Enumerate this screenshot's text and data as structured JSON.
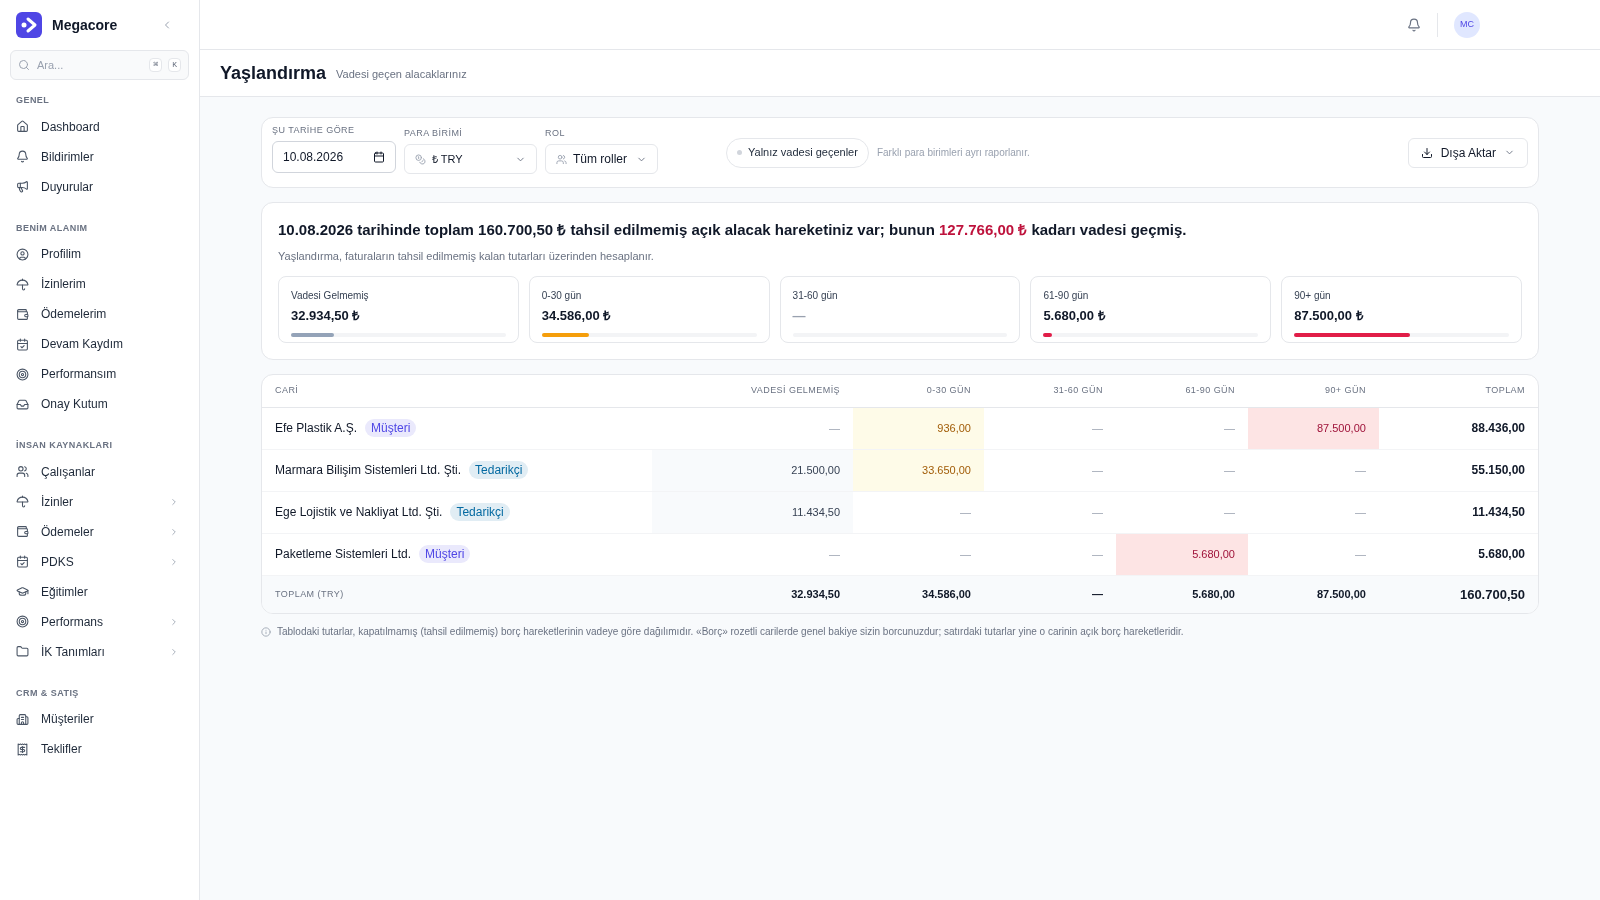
{
  "brand": {
    "name": "Megacore"
  },
  "search": {
    "placeholder": "Ara...",
    "keys": [
      "⌘",
      "K"
    ]
  },
  "sidebar": {
    "sections": [
      {
        "title": "GENEL",
        "items": [
          {
            "label": "Dashboard",
            "has_children": false
          },
          {
            "label": "Bildirimler",
            "has_children": false
          },
          {
            "label": "Duyurular",
            "has_children": false
          }
        ]
      },
      {
        "title": "BENİM ALANIM",
        "items": [
          {
            "label": "Profilim",
            "has_children": false
          },
          {
            "label": "İzinlerim",
            "has_children": false
          },
          {
            "label": "Ödemelerim",
            "has_children": false
          },
          {
            "label": "Devam Kaydım",
            "has_children": false
          },
          {
            "label": "Performansım",
            "has_children": false
          },
          {
            "label": "Onay Kutum",
            "has_children": false
          }
        ]
      },
      {
        "title": "İNSAN KAYNAKLARI",
        "items": [
          {
            "label": "Çalışanlar",
            "has_children": false
          },
          {
            "label": "İzinler",
            "has_children": true
          },
          {
            "label": "Ödemeler",
            "has_children": true
          },
          {
            "label": "PDKS",
            "has_children": true
          },
          {
            "label": "Eğitimler",
            "has_children": false
          },
          {
            "label": "Performans",
            "has_children": true
          },
          {
            "label": "İK Tanımları",
            "has_children": true
          }
        ]
      },
      {
        "title": "CRM & SATIŞ",
        "items": [
          {
            "label": "Müşteriler",
            "has_children": false
          },
          {
            "label": "Teklifler",
            "has_children": false
          }
        ]
      }
    ]
  },
  "topbar": {
    "avatar": "MC"
  },
  "page": {
    "title": "Yaşlandırma",
    "subtitle": "Vadesi geçen alacaklarınız"
  },
  "filters": {
    "date": {
      "label": "ŞU TARİHE GÖRE",
      "value": "10.08.2026"
    },
    "currency": {
      "label": "PARA BİRİMİ",
      "value": "₺ TRY"
    },
    "role": {
      "label": "ROL",
      "value": "Tüm roller"
    },
    "overdue_only": {
      "label": "Yalnız vadesi geçenler",
      "on": false
    },
    "note": "Farklı para birimleri ayrı raporlanır.",
    "export": "Dışa Aktar"
  },
  "summary": {
    "headline": "10.08.2026 tarihinde toplam **160.700,50 ₺** tahsil edilmemiş açık alacak hareketiniz var; bunun",
    "overdue": "127.766,00 ₺",
    "headline_end": "kadarı vadesi geçmiş.",
    "description": "Yaşlandırma, faturaların tahsil edilmemiş kalan tutarları üzerinden hesaplanır.",
    "buckets": [
      {
        "label": "Vadesi Gelmemiş",
        "value": "32.934,50 ₺",
        "level": 0.2,
        "color": "#94a3b8"
      },
      {
        "label": "0-30 gün",
        "value": "34.586,00 ₺",
        "level": 0.22,
        "color": "#f59e0b"
      },
      {
        "label": "31-60 gün",
        "value": "—",
        "level": 0
      },
      {
        "label": "61-90 gün",
        "value": "5.680,00 ₺",
        "level": 0.04,
        "color": "#e11d48"
      },
      {
        "label": "90+ gün",
        "value": "87.500,00 ₺",
        "level": 0.54,
        "color": "#e11d48"
      }
    ]
  },
  "table": {
    "columns": [
      "CARİ",
      "VADESİ GELMEMİŞ",
      "0-30 GÜN",
      "31-60 GÜN",
      "61-90 GÜN",
      "90+ GÜN",
      "TOPLAM"
    ],
    "rows": [
      {
        "cells": [
          {
            "kind": "account",
            "text": "Efe Plastik A.Ş.",
            "tag": {
              "label": "Müşteri",
              "color": "#4f46e5"
            }
          },
          {
            "kind": "empty",
            "text": "—"
          },
          {
            "kind": "warn",
            "text": "936,00"
          },
          {
            "kind": "empty",
            "text": "—"
          },
          {
            "kind": "empty",
            "text": "—"
          },
          {
            "kind": "danger",
            "text": "87.500,00"
          },
          {
            "kind": "total",
            "text": "88.436,00"
          }
        ]
      },
      {
        "cells": [
          {
            "kind": "account",
            "text": "Marmara Bilişim Sistemleri Ltd. Şti.",
            "tag": {
              "label": "Tedarikçi",
              "color": "#0369a1"
            }
          },
          {
            "kind": "muted",
            "text": "21.500,00"
          },
          {
            "kind": "warn",
            "text": "33.650,00"
          },
          {
            "kind": "empty",
            "text": "—"
          },
          {
            "kind": "empty",
            "text": "—"
          },
          {
            "kind": "empty",
            "text": "—"
          },
          {
            "kind": "total",
            "text": "55.150,00"
          }
        ]
      },
      {
        "cells": [
          {
            "kind": "account",
            "text": "Ege Lojistik ve Nakliyat Ltd. Şti.",
            "tag": {
              "label": "Tedarikçi",
              "color": "#0369a1"
            }
          },
          {
            "kind": "muted",
            "text": "11.434,50"
          },
          {
            "kind": "empty",
            "text": "—"
          },
          {
            "kind": "empty",
            "text": "—"
          },
          {
            "kind": "empty",
            "text": "—"
          },
          {
            "kind": "empty",
            "text": "—"
          },
          {
            "kind": "total",
            "text": "11.434,50"
          }
        ]
      },
      {
        "cells": [
          {
            "kind": "account",
            "text": "Paketleme Sistemleri Ltd.",
            "tag": {
              "label": "Müşteri",
              "color": "#4f46e5"
            }
          },
          {
            "kind": "empty",
            "text": "—"
          },
          {
            "kind": "empty",
            "text": "—"
          },
          {
            "kind": "empty",
            "text": "—"
          },
          {
            "kind": "danger",
            "text": "5.680,00"
          },
          {
            "kind": "empty",
            "text": "—"
          },
          {
            "kind": "total",
            "text": "5.680,00"
          }
        ]
      }
    ],
    "footer": [
      "TOPLAM (TRY)",
      "32.934,50",
      "34.586,00",
      "—",
      "5.680,00",
      "87.500,00",
      "160.700,50"
    ]
  },
  "footnote": "Tablodaki tutarlar, kapatılmamış (tahsil edilmemiş) borç hareketlerinin vadeye göre dağılımıdır. «Borç» rozetli carilerde genel bakiye sizin borcunuzdur; satırdaki tutarlar yine o carinin açık borç hareketleridir."
}
